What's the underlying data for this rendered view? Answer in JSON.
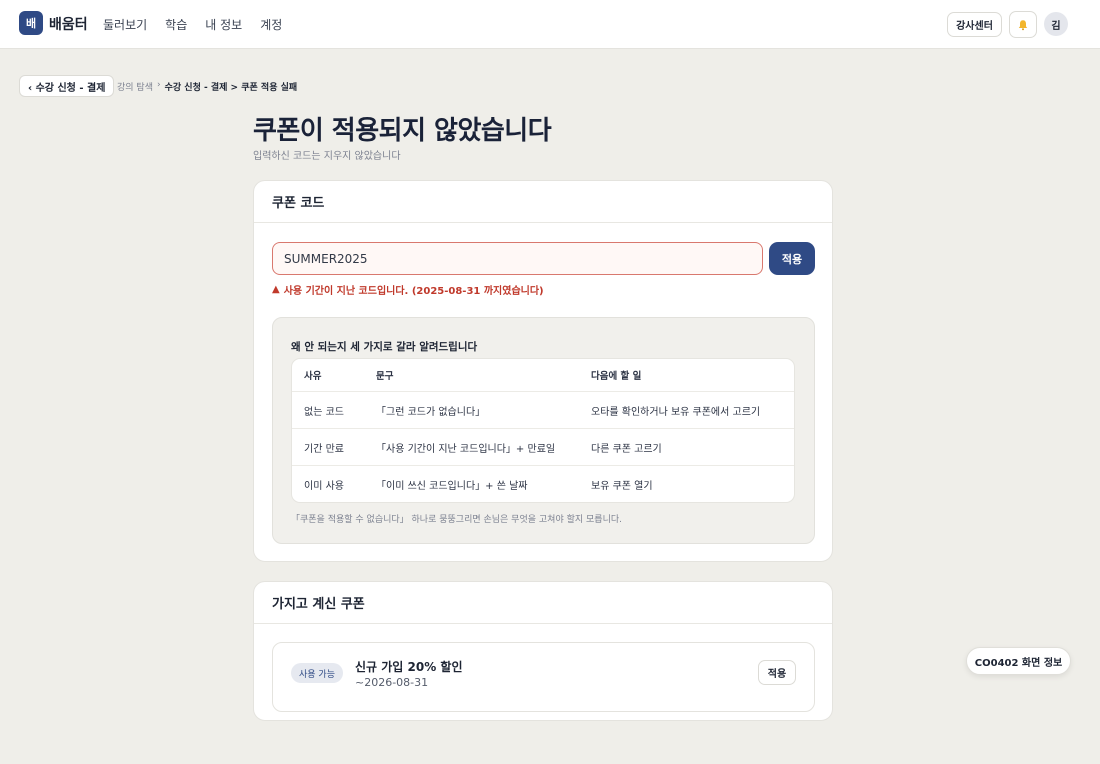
{
  "app": {
    "logo_mark": "배",
    "logo_text": "배움터"
  },
  "nav": {
    "links": [
      "둘러보기",
      "학습",
      "내 정보",
      "계정"
    ]
  },
  "header": {
    "instructor_label": "강사센터",
    "avatar_label": "김"
  },
  "breadcrumb": {
    "back_label": "‹ 수강 신청 - 결제",
    "root": "강의 탐색",
    "sep": "›",
    "current": "수강 신청 - 결제 > 쿠폰 적용 실패"
  },
  "page": {
    "title": "쿠폰이 적용되지 않았습니다",
    "subtitle": "입력하신 코드는 지우지 않았습니다"
  },
  "coupon_code_card": {
    "heading": "쿠폰 코드",
    "input_value": "SUMMER2025",
    "apply_label": "적용",
    "error_icon": "▲",
    "error_text": "사용 기간이 지난 코드입니다. (2025-08-31 까지였습니다)",
    "explain": {
      "title": "왜 안 되는지 세 가지로 갈라 알려드립니다",
      "headers": [
        "사유",
        "문구",
        "다음에 할 일"
      ],
      "rows": [
        [
          "없는 코드",
          "「그런 코드가 없습니다」",
          "오타를 확인하거나 보유 쿠폰에서 고르기"
        ],
        [
          "기간 만료",
          "「사용 기간이 지난 코드입니다」+ 만료일",
          "다른 쿠폰 고르기"
        ],
        [
          "이미 사용",
          "「이미 쓰신 코드입니다」+ 쓴 날짜",
          "보유 쿠폰 열기"
        ]
      ],
      "note": "「쿠폰을 적용할 수 없습니다」 하나로 뭉뚱그리면 손님은 무엇을 고쳐야 할지 모릅니다."
    }
  },
  "owned_coupons_card": {
    "heading": "가지고 계신 쿠폰",
    "items": [
      {
        "badge": "사용 가능",
        "name": "신규 가입 20% 할인",
        "expires": "~2026-08-31",
        "apply_label": "적용"
      }
    ]
  },
  "screen_info_label": "CO0402 화면 정보",
  "colors": {
    "brand": "#2f4a85",
    "error": "#c0392b",
    "background": "#efeee9"
  }
}
